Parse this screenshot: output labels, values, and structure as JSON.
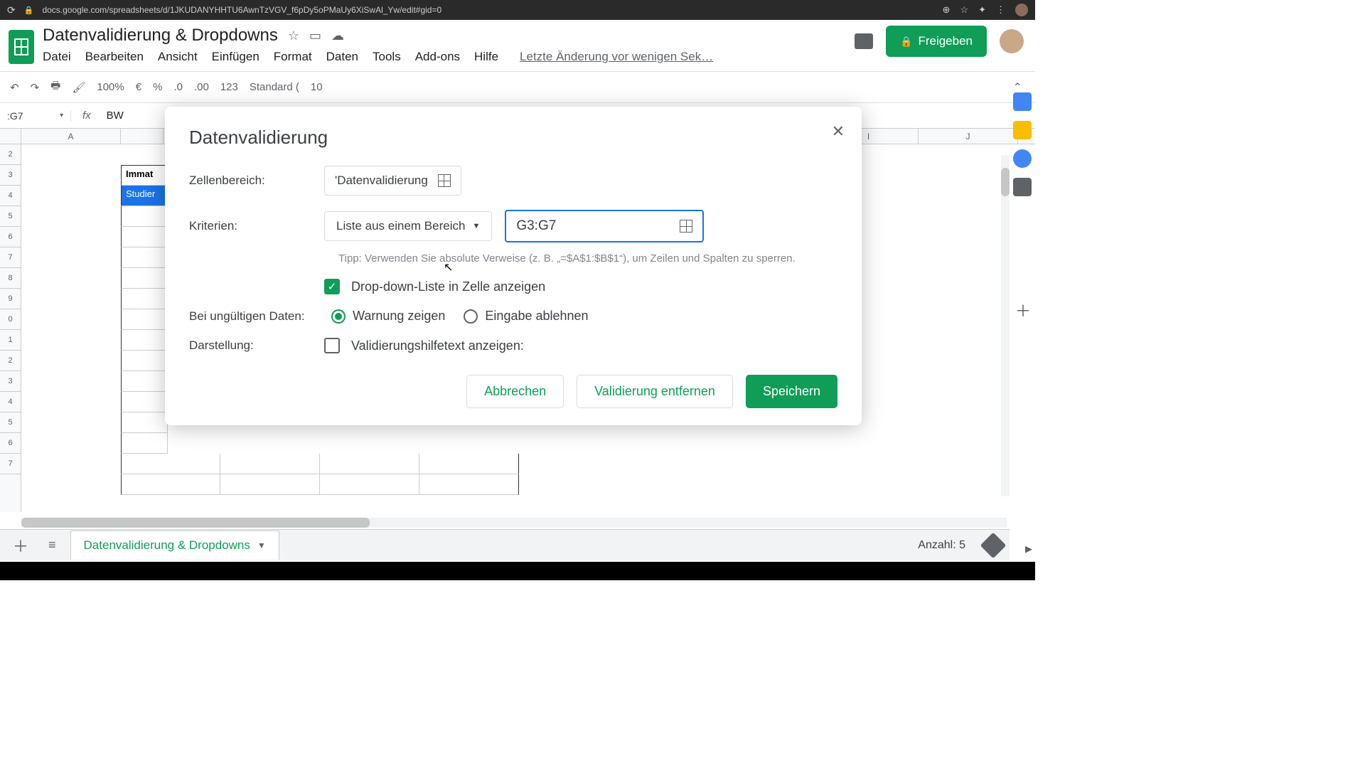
{
  "browser": {
    "url": "docs.google.com/spreadsheets/d/1JKUDANYHHTU6AwnTzVGV_f6pDy5oPMaUy6XiSwAl_Yw/edit#gid=0"
  },
  "header": {
    "doc_title": "Datenvalidierung & Dropdowns",
    "last_edit": "Letzte Änderung vor wenigen Sek…",
    "share_label": "Freigeben"
  },
  "menu": {
    "file": "Datei",
    "edit": "Bearbeiten",
    "view": "Ansicht",
    "insert": "Einfügen",
    "format": "Format",
    "data": "Daten",
    "tools": "Tools",
    "addons": "Add-ons",
    "help": "Hilfe"
  },
  "toolbar": {
    "zoom": "100%",
    "currency": "€",
    "percent": "%",
    "dec_dec": ".0",
    "dec_inc": ".00",
    "more_formats": "123",
    "font": "Standard (",
    "size": "10"
  },
  "fx": {
    "name_box": ":G7",
    "fx_label": "fx",
    "value": "BW"
  },
  "columns": {
    "A": "A",
    "I": "I",
    "J": "J"
  },
  "rows": [
    "2",
    "3",
    "4",
    "5",
    "6",
    "7",
    "8",
    "9",
    "0",
    "1",
    "2",
    "3",
    "4",
    "5",
    "6",
    "7"
  ],
  "sheet_cells": {
    "heading": "Immat",
    "selected": "Studier"
  },
  "dialog": {
    "title": "Datenvalidierung",
    "label_range": "Zellenbereich:",
    "range_value": "'Datenvalidierung",
    "label_criteria": "Kriterien:",
    "criteria_dropdown": "Liste aus einem Bereich",
    "criteria_range": "G3:G7",
    "tip": "Tipp: Verwenden Sie absolute Verweise (z. B. „=$A$1:$B$1“), um Zeilen und Spalten zu sperren.",
    "show_dropdown": "Drop-down-Liste in Zelle anzeigen",
    "label_invalid": "Bei ungültigen Daten:",
    "warn": "Warnung zeigen",
    "reject": "Eingabe ablehnen",
    "label_appearance": "Darstellung:",
    "show_help": "Validierungshilfetext anzeigen:",
    "btn_cancel": "Abbrechen",
    "btn_remove": "Validierung entfernen",
    "btn_save": "Speichern"
  },
  "bottom": {
    "sheet_name": "Datenvalidierung & Dropdowns",
    "count": "Anzahl: 5"
  }
}
